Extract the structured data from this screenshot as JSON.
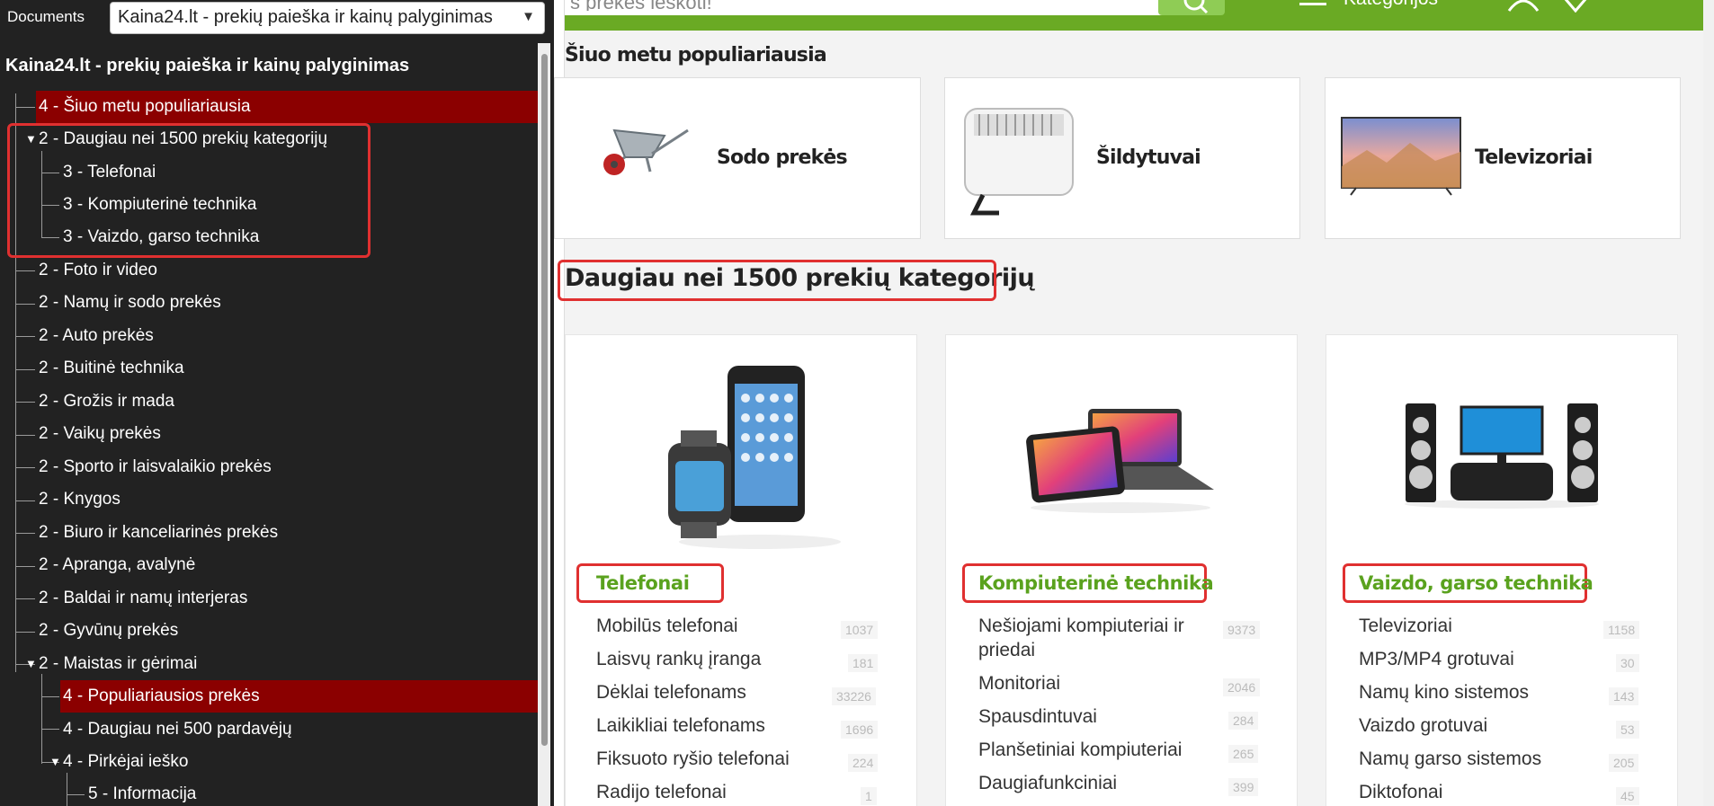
{
  "outline_panel": {
    "documents_label": "Documents",
    "selected_document": "Kaina24.lt - prekių paieška ir kainų palyginimas",
    "title": "Kaina24.lt - prekių paieška ir kainų palyginimas",
    "items": [
      {
        "label": "4 - Šiuo metu populiariausia",
        "highlighted": true
      },
      {
        "label": "2 - Daugiau nei 1500 prekių kategorijų",
        "expanded": true
      },
      {
        "label": "3 - Telefonai"
      },
      {
        "label": "3 - Kompiuterinė technika"
      },
      {
        "label": "3 - Vaizdo, garso technika"
      },
      {
        "label": "2 - Foto ir video"
      },
      {
        "label": "2 - Namų ir sodo prekės"
      },
      {
        "label": "2 - Auto prekės"
      },
      {
        "label": "2 - Buitinė technika"
      },
      {
        "label": "2 - Grožis ir mada"
      },
      {
        "label": "2 - Vaikų prekės"
      },
      {
        "label": "2 - Sporto ir laisvalaikio prekės"
      },
      {
        "label": "2 - Knygos"
      },
      {
        "label": "2 - Biuro ir kanceliarinės prekės"
      },
      {
        "label": "2 - Apranga, avalynė"
      },
      {
        "label": "2 - Baldai ir namų interjeras"
      },
      {
        "label": "2 - Gyvūnų prekės"
      },
      {
        "label": "2 - Maistas ir gėrimai",
        "expanded": true
      },
      {
        "label": "4 - Populiariausios prekės",
        "highlighted": true
      },
      {
        "label": "4 - Daugiau nei 500 pardavėjų"
      },
      {
        "label": "4 - Pirkėjai ieško",
        "expanded": true
      },
      {
        "label": "5 - Informacija"
      }
    ]
  },
  "header": {
    "search_placeholder": "s prekės ieškoti!",
    "menu_label": "Kategorijos",
    "accent_color": "#6aaa24"
  },
  "popular": {
    "heading": "Šiuo metu populiariausia",
    "cards": [
      {
        "label": "Sodo prekės",
        "icon": "wheelbarrow-image"
      },
      {
        "label": "Šildytuvai",
        "icon": "heater-image"
      },
      {
        "label": "Televizoriai",
        "icon": "tv-image"
      }
    ]
  },
  "categories": {
    "heading": "Daugiau nei 1500 prekių kategorijų",
    "cards": [
      {
        "title": "Telefonai",
        "image": "phones-image",
        "items": [
          {
            "name": "Mobilūs telefonai",
            "count": "1037"
          },
          {
            "name": "Laisvų rankų įranga",
            "count": "181"
          },
          {
            "name": "Dėklai telefonams",
            "count": "33226"
          },
          {
            "name": "Laikikliai telefonams",
            "count": "1696"
          },
          {
            "name": "Fiksuoto ryšio telefonai",
            "count": "224"
          },
          {
            "name": "Radijo telefonai",
            "count": "1"
          }
        ]
      },
      {
        "title": "Kompiuterinė technika",
        "image": "laptops-image",
        "items": [
          {
            "name": "Nešiojami kompiuteriai ir",
            "name2": "priedai",
            "count": "9373"
          },
          {
            "name": "Monitoriai",
            "count": "2046"
          },
          {
            "name": "Spausdintuvai",
            "count": "284"
          },
          {
            "name": "Planšetiniai kompiuteriai",
            "count": "265"
          },
          {
            "name": "Daugiafunkciniai",
            "count": "399"
          }
        ]
      },
      {
        "title": "Vaizdo, garso technika",
        "image": "home-theater-image",
        "items": [
          {
            "name": "Televizoriai",
            "count": "1158"
          },
          {
            "name": "MP3/MP4 grotuvai",
            "count": "30"
          },
          {
            "name": "Namų kino sistemos",
            "count": "143"
          },
          {
            "name": "Vaizdo grotuvai",
            "count": "53"
          },
          {
            "name": "Namų garso sistemos",
            "count": "205"
          },
          {
            "name": "Diktofonai",
            "count": "45"
          }
        ]
      }
    ]
  }
}
